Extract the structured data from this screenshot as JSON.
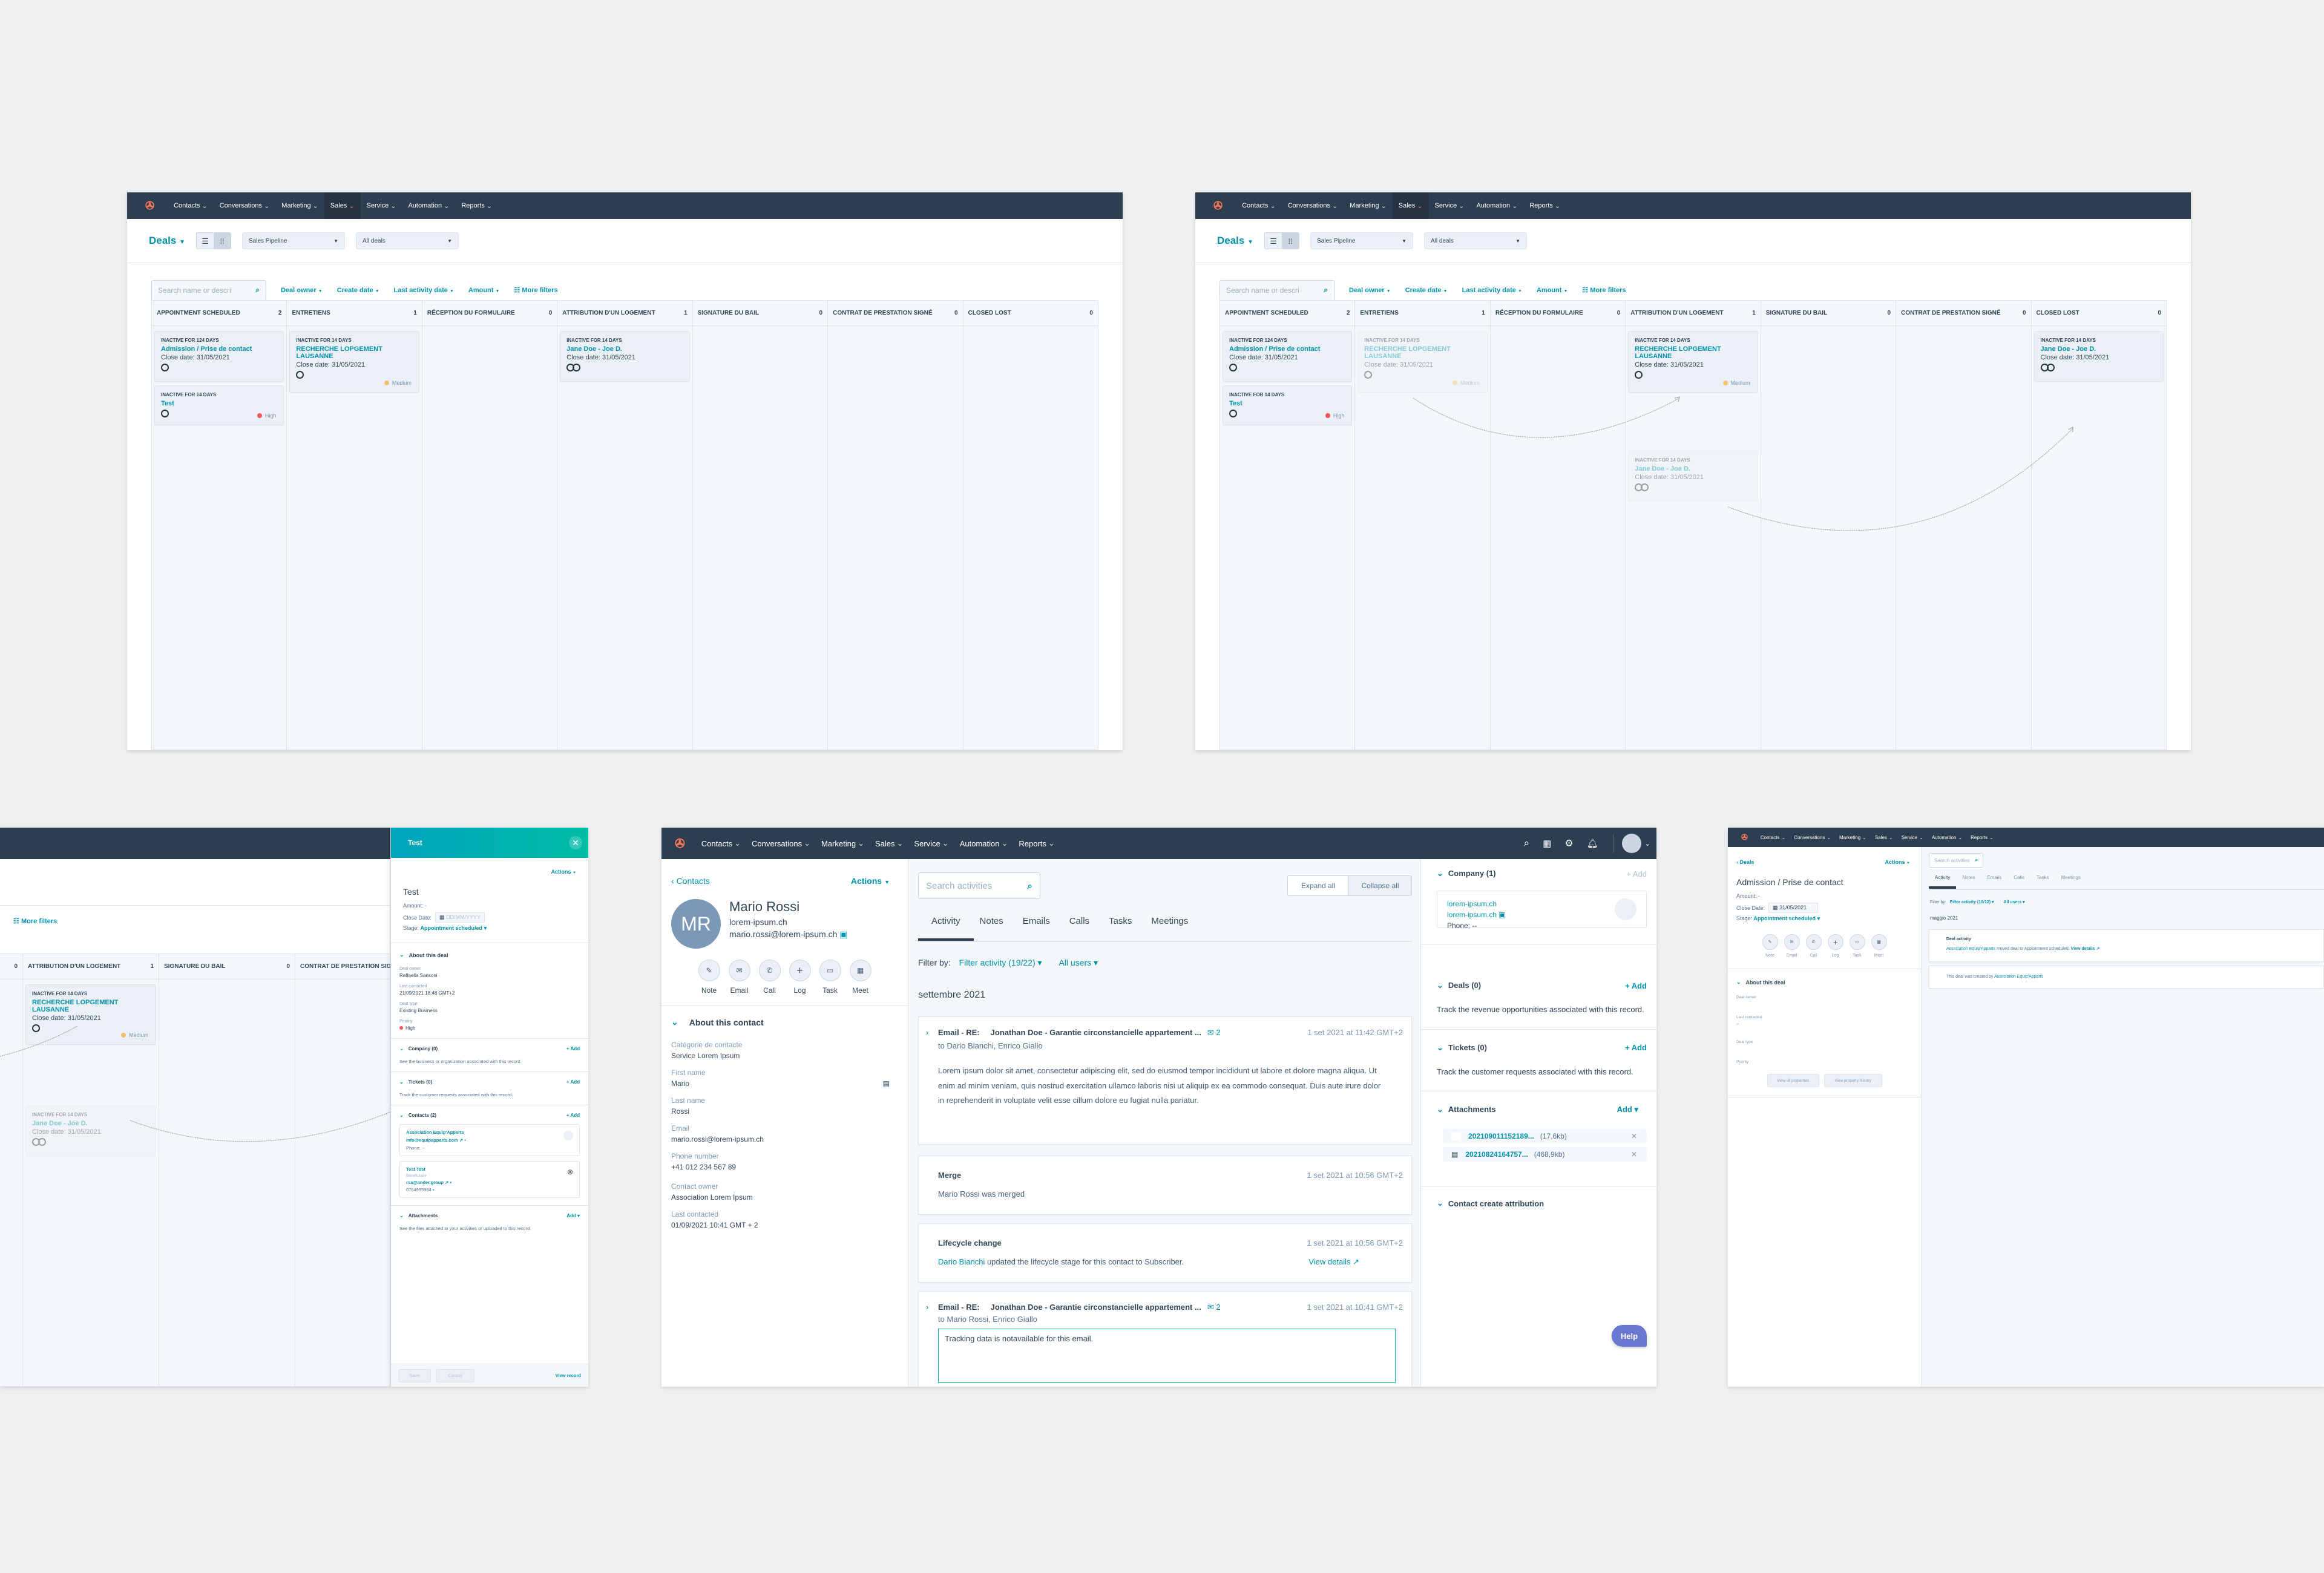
{
  "nav": {
    "items": [
      "Contacts",
      "Conversations",
      "Marketing",
      "Sales",
      "Service",
      "Automation",
      "Reports"
    ],
    "active": "Sales",
    "logo": "hubspot-sprocket-icon"
  },
  "board": {
    "title": "Deals",
    "pipeline": "Sales Pipeline",
    "view": "All deals",
    "search_placeholder": "Search name or descri",
    "filters": [
      "Deal owner",
      "Create date",
      "Last activity date",
      "Amount"
    ],
    "more_filters": "More filters",
    "columns": [
      {
        "name": "APPOINTMENT SCHEDULED",
        "count": "2"
      },
      {
        "name": "ENTRETIENS",
        "count": "1"
      },
      {
        "name": "RÉCEPTION DU FORMULAIRE",
        "count": "0"
      },
      {
        "name": "ATTRIBUTION D'UN LOGEMENT",
        "count": "1"
      },
      {
        "name": "SIGNATURE DU BAIL",
        "count": "0"
      },
      {
        "name": "CONTRAT DE PRESTATION SIGNÉ",
        "count": "0"
      },
      {
        "name": "CLOSED LOST",
        "count": "0"
      }
    ],
    "cards": {
      "admission": {
        "inactive": "INACTIVE FOR 124 DAYS",
        "title": "Admission / Prise de contact",
        "close": "Close date: 31/05/2021"
      },
      "test": {
        "inactive": "INACTIVE FOR 14 DAYS",
        "title": "Test",
        "priority": "High"
      },
      "recherche": {
        "inactive": "INACTIVE FOR 14 DAYS",
        "title1": "RECHERCHE LOPGEMENT",
        "title2": "LAUSANNE",
        "close": "Close date: 31/05/2021",
        "priority": "Medium"
      },
      "jane": {
        "inactive": "INACTIVE FOR 14 DAYS",
        "title": "Jane Doe - Joe D.",
        "close": "Close date: 31/05/2021"
      }
    },
    "colors": {
      "high": "#f2545b",
      "medium": "#f5c26b",
      "accent": "#0091ae"
    }
  },
  "deal_panel": {
    "header": "Test",
    "actions": "Actions",
    "name": "Test",
    "amount": "Amount: -",
    "close_label": "Close Date:",
    "close_placeholder": "DD/MM/YYYY",
    "stage_label": "Stage:",
    "stage": "Appointment scheduled",
    "about": "About this deal",
    "props": [
      {
        "label": "Deal owner",
        "value": "Raffaella Sansoni"
      },
      {
        "label": "Last contacted",
        "value": "21/09/2021 18:48 GMT+2"
      },
      {
        "label": "Deal type",
        "value": "Existing Business"
      },
      {
        "label": "Priority",
        "value": "High"
      }
    ],
    "company": {
      "title": "Company (0)",
      "add": "+ Add",
      "desc": "See the business or organization associated with this record."
    },
    "tickets": {
      "title": "Tickets (0)",
      "add": "+ Add",
      "desc": "Track the customer requests associated with this record."
    },
    "contacts": {
      "title": "Contacts (2)",
      "add": "+ Add",
      "items": [
        {
          "name": "Association Equip'Apparts",
          "email": "info@equipapparts.com",
          "phone": "Phone: --"
        },
        {
          "name": "Test Test",
          "role": "Bénéficiaire",
          "email": "rsa@ander.group",
          "phone": "0764995984"
        }
      ]
    },
    "attachments": {
      "title": "Attachments",
      "add": "Add",
      "desc": "See the files attached to your activities or uploaded to this record."
    },
    "save": "Save",
    "cancel": "Cancel",
    "view_record": "View record"
  },
  "contact": {
    "back": "Contacts",
    "actions": "Actions",
    "initials": "MR",
    "name": "Mario Rossi",
    "domain": "lorem-ipsum.ch",
    "email": "mario.rossi@lorem-ipsum.ch",
    "quick_actions": [
      "Note",
      "Email",
      "Call",
      "Log",
      "Task",
      "Meet"
    ],
    "about": "About this contact",
    "props": [
      {
        "label": "Catégorie de contacte",
        "value": "Service Lorem Ipsum"
      },
      {
        "label": "First name",
        "value": "Mario"
      },
      {
        "label": "Last name",
        "value": "Rossi"
      },
      {
        "label": "Email",
        "value": "mario.rossi@lorem-ipsum.ch"
      },
      {
        "label": "Phone number",
        "value": "+41 012 234 567 89"
      },
      {
        "label": "Contact owner",
        "value": "Association Lorem Ipsum"
      },
      {
        "label": "Last contacted",
        "value": "01/09/2021 10:41 GMT + 2"
      }
    ],
    "search_placeholder": "Search activities",
    "expand_all": "Expand all",
    "collapse_all": "Collapse all",
    "tabs": [
      "Activity",
      "Notes",
      "Emails",
      "Calls",
      "Tasks",
      "Meetings"
    ],
    "filter_label": "Filter by:",
    "filter_activity": "Filter activity (19/22)",
    "all_users": "All users",
    "month": "settembre 2021",
    "timeline": [
      {
        "type": "Email - RE:",
        "subject": "Jonathan Doe - Garantie circonstancielle appartement ...",
        "count": "2",
        "time": "1 set 2021 at 11:42 GMT+2",
        "to": "to Dario Bianchi, Enrico Giallo",
        "body": "Lorem ipsum dolor sit amet, consectetur adipiscing elit, sed do eiusmod tempor incididunt ut labore et dolore magna aliqua. Ut enim ad minim veniam, quis nostrud exercitation ullamco laboris nisi ut aliquip ex ea commodo consequat. Duis aute irure dolor in reprehenderit in voluptate velit esse cillum dolore eu fugiat nulla pariatur."
      },
      {
        "type": "Merge",
        "time": "1 set 2021 at 10:56 GMT+2",
        "body": "Mario Rossi was merged"
      },
      {
        "type": "Lifecycle change",
        "time": "1 set 2021 at 10:56 GMT+2",
        "actor": "Dario Bianchi",
        "body": "updated the lifecycle stage for this contact to Subscriber.",
        "link": "View details"
      },
      {
        "type": "Email - RE:",
        "subject": "Jonathan Doe - Garantie circonstancielle appartement ...",
        "count": "2",
        "time": "1 set 2021 at 10:41 GMT+2",
        "to": "to Mario Rossi, Enrico Giallo",
        "tracking": "Tracking data is notavailable for this email."
      }
    ],
    "company": {
      "title": "Company (1)",
      "add": "+ Add",
      "name": "lorem-ipsum.ch",
      "domain": "lorem-ipsum.ch",
      "phone": "Phone: --"
    },
    "deals": {
      "title": "Deals (0)",
      "add": "+ Add",
      "desc": "Track the revenue opportunities associated with this record."
    },
    "tickets": {
      "title": "Tickets (0)",
      "add": "+ Add",
      "desc": "Track the customer requests associated with this record."
    },
    "attachments": {
      "title": "Attachments",
      "add": "Add",
      "files": [
        {
          "name": "202109011152189...",
          "size": "(17,6kb)"
        },
        {
          "name": "20210824164757...",
          "size": "(468,9kb)"
        }
      ]
    },
    "attribution": "Contact create attribution",
    "help": "Help"
  },
  "deal_record": {
    "back": "Deals",
    "actions": "Actions",
    "name": "Admission / Prise de contact",
    "amount": "Amount: -",
    "close_label": "Close Date:",
    "close": "31/05/2021",
    "stage_label": "Stage:",
    "stage": "Appointment scheduled",
    "quick_actions": [
      "Note",
      "Email",
      "Call",
      "Log",
      "Task",
      "Meet"
    ],
    "about": "About this deal",
    "props": [
      {
        "label": "Deal owner",
        "value": ""
      },
      {
        "label": "Last contacted",
        "value": "--"
      },
      {
        "label": "Deal type",
        "value": ""
      },
      {
        "label": "Priority",
        "value": ""
      }
    ],
    "view_all": "View all properties",
    "view_history": "View property history",
    "search_placeholder": "Search activities",
    "tabs": [
      "Activity",
      "Notes",
      "Emails",
      "Calls",
      "Tasks",
      "Meetings"
    ],
    "filter_label": "Filter by:",
    "filter_activity": "Filter activity (10/12)",
    "all_users": "All users",
    "month": "maggio 2021",
    "activity_title": "Deal activity",
    "activity_actor": "Association Equip'Apparts",
    "activity_text": "moved deal to Appointment scheduled.",
    "activity_link": "View details",
    "created_text": "This deal was created by",
    "created_by": "Association Equip'Apparts"
  }
}
